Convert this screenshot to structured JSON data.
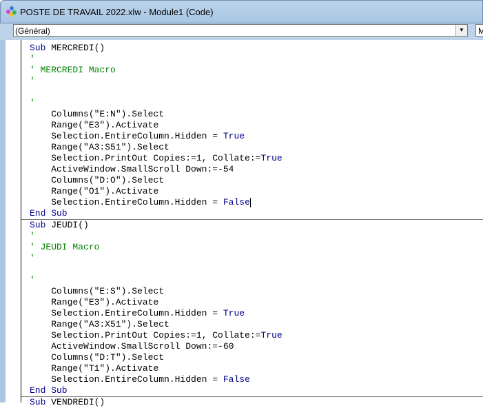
{
  "window": {
    "title": "POSTE DE TRAVAIL 2022.xlw - Module1 (Code)"
  },
  "object_combo": {
    "value": "(Général)"
  },
  "procedure_combo": {
    "value": "M"
  },
  "code_lines": [
    [
      [
        "kw",
        "Sub "
      ],
      [
        "",
        "MERCREDI()"
      ]
    ],
    [
      [
        "cm",
        "'"
      ]
    ],
    [
      [
        "cm",
        "' MERCREDI Macro"
      ]
    ],
    [
      [
        "cm",
        "'"
      ]
    ],
    [],
    [
      [
        "cm",
        "'"
      ]
    ],
    [
      [
        "",
        "    Columns(\"E:N\").Select"
      ]
    ],
    [
      [
        "",
        "    Range(\"E3\").Activate"
      ]
    ],
    [
      [
        "",
        "    Selection.EntireColumn.Hidden = "
      ],
      [
        "kw",
        "True"
      ]
    ],
    [
      [
        "",
        "    Range(\"A3:S51\").Select"
      ]
    ],
    [
      [
        "",
        "    Selection.PrintOut Copies:=1, Collate:="
      ],
      [
        "kw",
        "True"
      ]
    ],
    [
      [
        "",
        "    ActiveWindow.SmallScroll Down:=-54"
      ]
    ],
    [
      [
        "",
        "    Columns(\"D:O\").Select"
      ]
    ],
    [
      [
        "",
        "    Range(\"O1\").Activate"
      ]
    ],
    [
      [
        "",
        "    Selection.EntireColumn.Hidden = "
      ],
      [
        "kw",
        "False"
      ],
      [
        "caret",
        ""
      ]
    ],
    [
      [
        "kw",
        "End Sub"
      ]
    ],
    [
      [
        "kw",
        "Sub "
      ],
      [
        "",
        "JEUDI()"
      ]
    ],
    [
      [
        "cm",
        "'"
      ]
    ],
    [
      [
        "cm",
        "' JEUDI Macro"
      ]
    ],
    [
      [
        "cm",
        "'"
      ]
    ],
    [],
    [
      [
        "cm",
        "'"
      ]
    ],
    [
      [
        "",
        "    Columns(\"E:S\").Select"
      ]
    ],
    [
      [
        "",
        "    Range(\"E3\").Activate"
      ]
    ],
    [
      [
        "",
        "    Selection.EntireColumn.Hidden = "
      ],
      [
        "kw",
        "True"
      ]
    ],
    [
      [
        "",
        "    Range(\"A3:X51\").Select"
      ]
    ],
    [
      [
        "",
        "    Selection.PrintOut Copies:=1, Collate:="
      ],
      [
        "kw",
        "True"
      ]
    ],
    [
      [
        "",
        "    ActiveWindow.SmallScroll Down:=-60"
      ]
    ],
    [
      [
        "",
        "    Columns(\"D:T\").Select"
      ]
    ],
    [
      [
        "",
        "    Range(\"T1\").Activate"
      ]
    ],
    [
      [
        "",
        "    Selection.EntireColumn.Hidden = "
      ],
      [
        "kw",
        "False"
      ]
    ],
    [
      [
        "kw",
        "End Sub"
      ]
    ],
    [
      [
        "kw",
        "Sub "
      ],
      [
        "",
        "VENDREDI()"
      ]
    ]
  ]
}
